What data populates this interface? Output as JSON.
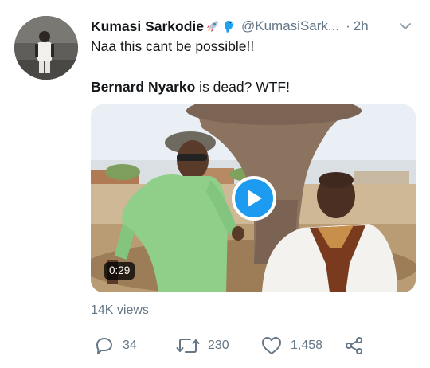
{
  "tweet": {
    "author_name": "Kumasi Sarkodie",
    "author_handle": "@KumasiSark...",
    "separator": "·",
    "time": "2h",
    "text_line1": "Naa this cant be possible!!",
    "text_line2_bold": "Bernard Nyarko",
    "text_line2_rest": " is dead? WTF!",
    "emojis": [
      "rocket-emoji",
      "parrot-emoji"
    ]
  },
  "video": {
    "duration": "0:29",
    "views": "14K views",
    "play_icon": "play-icon"
  },
  "actions": {
    "reply_count": "34",
    "retweet_count": "230",
    "like_count": "1,458"
  },
  "colors": {
    "text": "#14171a",
    "muted": "#657786",
    "play_button": "#1d9bf0",
    "link_blue": "#1da1f2"
  }
}
